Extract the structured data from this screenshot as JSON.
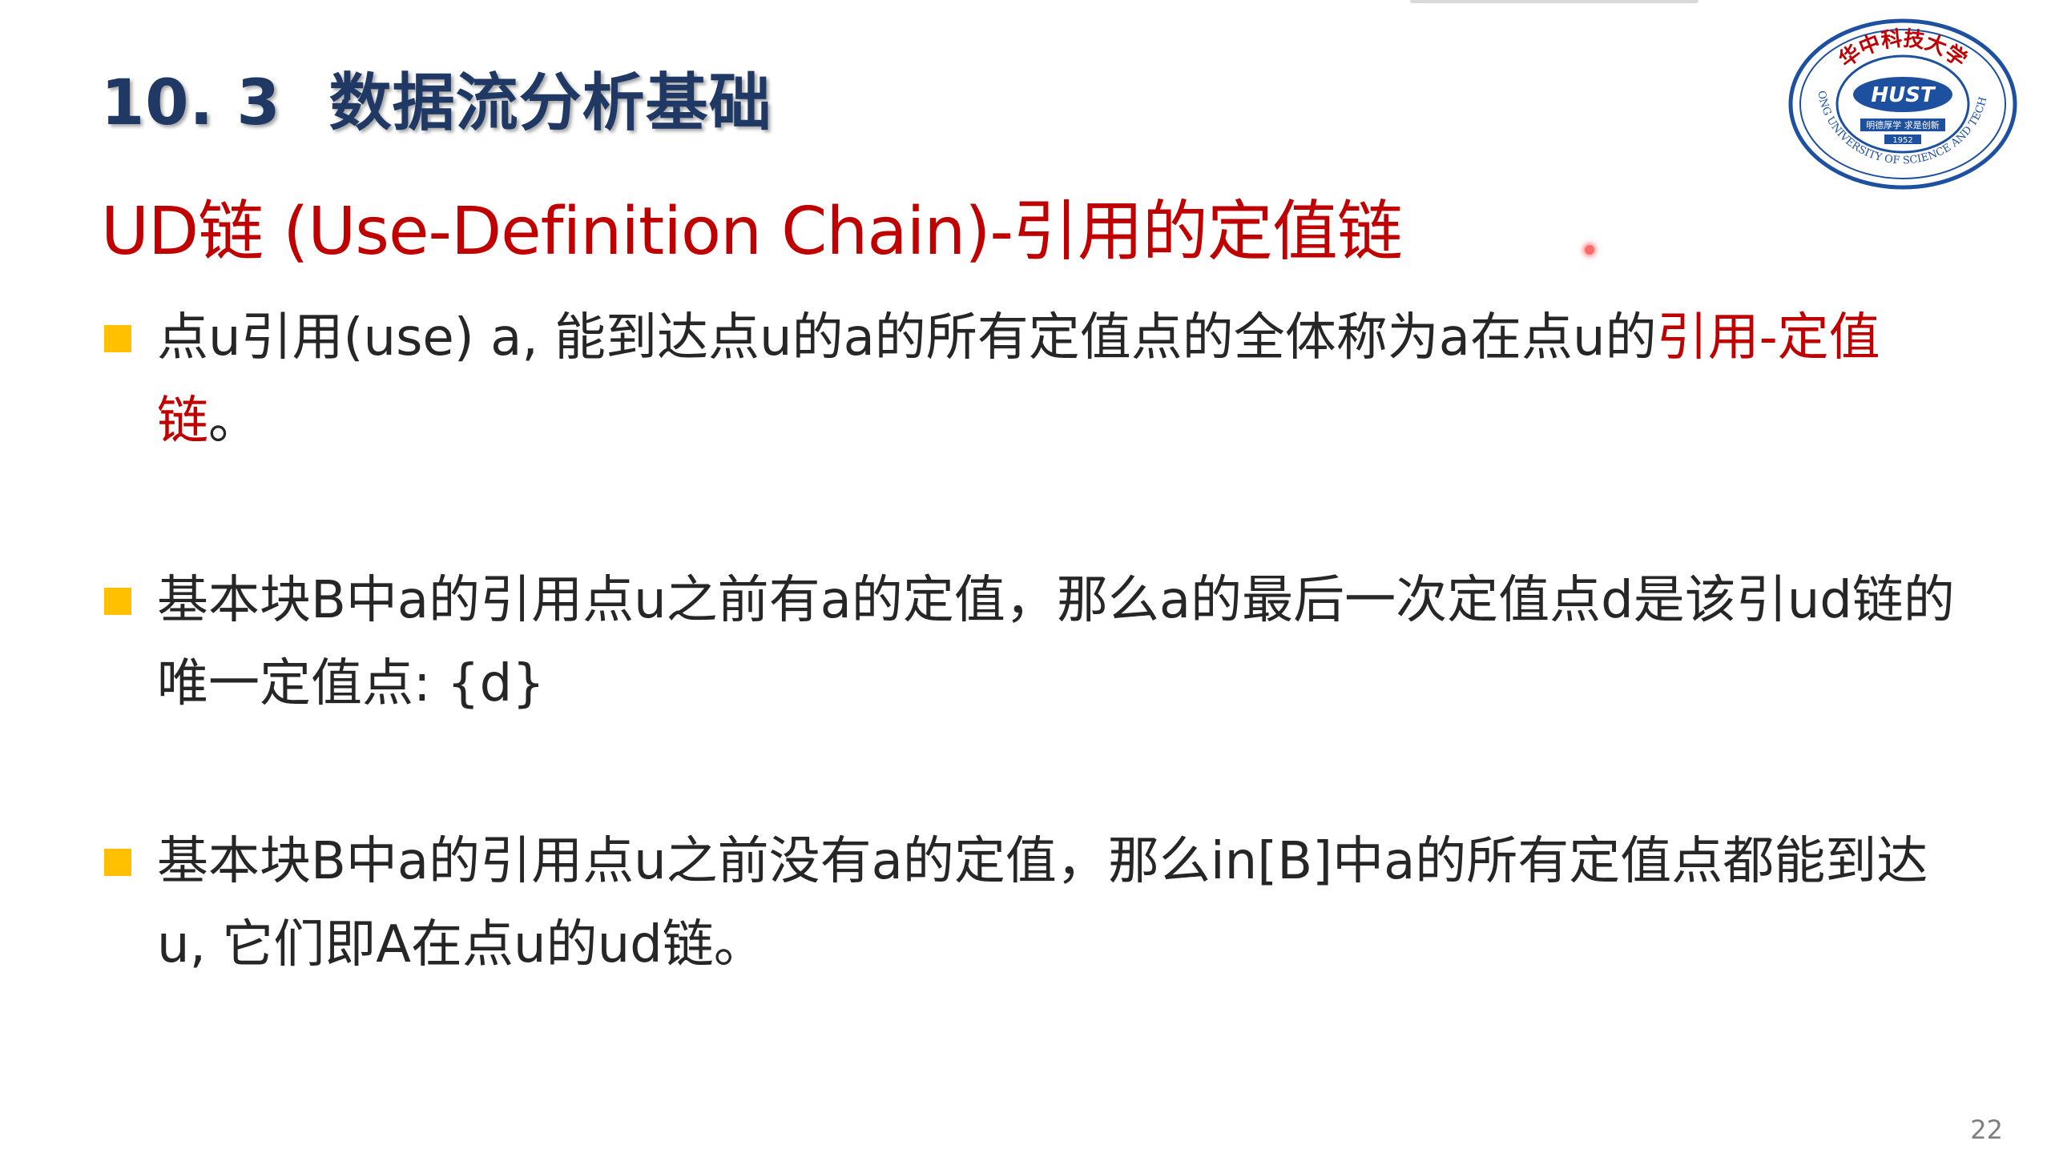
{
  "slide": {
    "section_number": "10. 3",
    "section_title": "数据流分析基础",
    "heading": "UD链 (Use-Definition Chain)-引用的定值链",
    "bullets": [
      {
        "text": "点u引用(use) a, 能到达点u的a的所有定值点的全体称为a在点u的",
        "highlight": "引用-定值链",
        "text_after": "。"
      },
      {
        "text": "基本块B中a的引用点u之前有a的定值，那么a的最后一次定值点d是该引ud链的唯一定值点: {d}"
      },
      {
        "text": "基本块B中a的引用点u之前没有a的定值，那么in[B]中a的所有定值点都能到达u, 它们即A在点u的ud链。"
      }
    ],
    "page_number": "22"
  },
  "logo": {
    "name": "university-logo",
    "arc_text_top": "华中科技大学",
    "arc_text_bottom": "HUAZHONG UNIVERSITY OF SCIENCE AND TECHNOLOGY",
    "monogram": "HUST",
    "motto": "明德厚学 求是创新",
    "year": "1952"
  },
  "colors": {
    "title": "#1f3864",
    "heading": "#c00000",
    "body": "#262626",
    "bullet_marker": "#ffc000",
    "logo_blue": "#1e50a0",
    "logo_red": "#c00000"
  }
}
